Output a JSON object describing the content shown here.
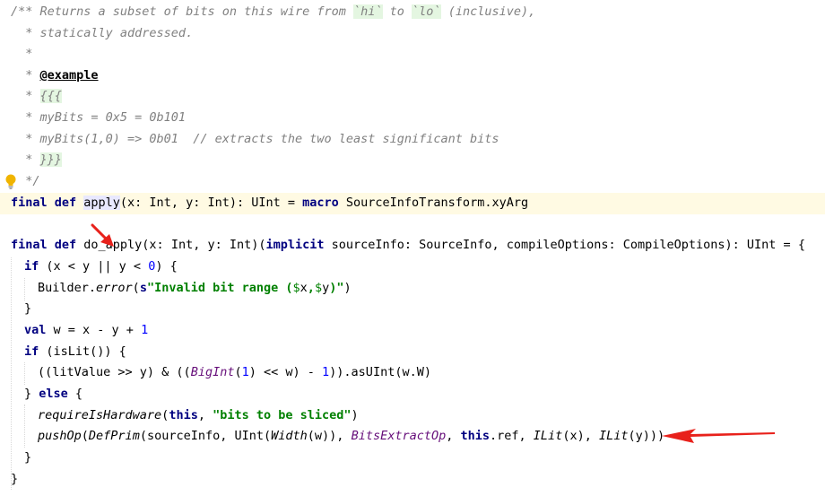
{
  "code": {
    "doc": {
      "l1_pre": "/** Returns a subset of bits on this wire from ",
      "l1_hi": "`hi`",
      "l1_mid": " to ",
      "l1_lo": "`lo`",
      "l1_post": " (inclusive),",
      "l2": "  * statically addressed.",
      "l3": "  *",
      "l4_star": "  * ",
      "l4_tag": "@example",
      "l5_star": "  * ",
      "l5_brace": "{{{",
      "l6": "  * myBits = 0x5 = 0b101",
      "l7": "  * myBits(1,0) => 0b01  // extracts the two least significant bits",
      "l8_star": "  * ",
      "l8_brace": "}}}",
      "l9": "  */"
    },
    "apply": {
      "kw": "final def ",
      "name": "apply",
      "rest": "(x: Int, y: Int): UInt = ",
      "macro": "macro",
      "tail": " SourceInfoTransform.xyArg"
    },
    "do_apply": {
      "kw": "final def ",
      "name": "do_apply(x: Int, y: Int)(",
      "implicit": "implicit",
      "tail": " sourceInfo: SourceInfo, compileOptions: CompileOptions): UInt = {"
    },
    "if1": {
      "kw": "if",
      "pre": " (x < y || y < ",
      "zero": "0",
      "post": ") {"
    },
    "builder": {
      "pre": "Builder.",
      "error": "error",
      "open": "(",
      "s": "s",
      "str1": "\"Invalid bit range (",
      "d1": "$",
      "x": "x",
      "comma": ",",
      "d2": "$",
      "y": "y",
      "str2": ")\"",
      "close": ")"
    },
    "close1": "}",
    "val": {
      "kw": "val",
      "pre": " w = x - y + ",
      "one": "1"
    },
    "if2": {
      "kw": "if",
      "post": " (isLit()) {"
    },
    "lit": {
      "pre": "((litValue >> y) & ((",
      "bigint": "BigInt",
      "open": "(",
      "one": "1",
      "mid": ") << w) - ",
      "one2": "1",
      "post": ")).asUInt(w.W)"
    },
    "else": {
      "pre": "} ",
      "kw": "else",
      "post": " {"
    },
    "require": {
      "fn": "requireIsHardware",
      "open": "(",
      "this": "this",
      "comma": ", ",
      "str": "\"bits to be sliced\"",
      "close": ")"
    },
    "push": {
      "fn": "pushOp",
      "open": "(",
      "defprim": "DefPrim",
      "p1": "(sourceInfo, UInt(",
      "width": "Width",
      "p2": "(w)), ",
      "bext": "BitsExtractOp",
      "comma": ", ",
      "this": "this",
      "p3": ".ref, ",
      "ilit1": "ILit",
      "p4": "(x), ",
      "ilit2": "ILit",
      "p5": "(y)))"
    },
    "close2": "}",
    "close3": "}"
  },
  "colors": {
    "arrow": "#e8211b",
    "bulb": "#f0b400",
    "current_line": "#fffae3"
  }
}
